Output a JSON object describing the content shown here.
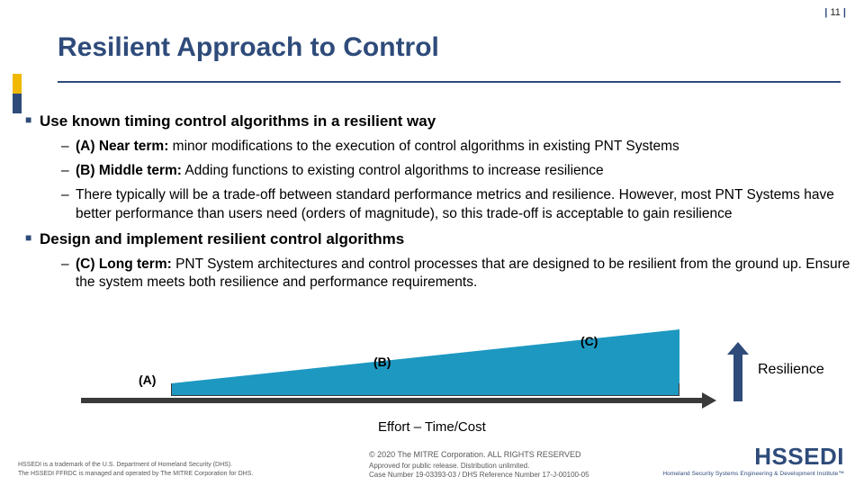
{
  "page": {
    "num": "11"
  },
  "title": "Resilient Approach to Control",
  "bullets": {
    "a": {
      "head": "Use known timing control algorithms in a resilient way",
      "i1label": "(A) Near term:",
      "i1text": " minor modifications to the execution of control algorithms in existing PNT Systems",
      "i2label": "(B) Middle term:",
      "i2text": " Adding functions to existing control algorithms to increase resilience",
      "i3text": "There typically will be a trade-off between standard performance metrics and resilience.  However, most PNT Systems have better performance than users need (orders of magnitude), so this trade-off is acceptable to gain resilience"
    },
    "b": {
      "head": "Design and implement resilient control algorithms",
      "i1label": "(C) Long term:",
      "i1text": " PNT System architectures and control processes that are designed to be resilient from the ground up.  Ensure the system meets both resilience and performance requirements."
    }
  },
  "diagram": {
    "A": "(A)",
    "B": "(B)",
    "C": "(C)",
    "xlabel": "Effort – Time/Cost",
    "ylabel": "Resilience"
  },
  "footer": {
    "copyright": "© 2020 The MITRE Corporation. ALL RIGHTS RESERVED",
    "approved": "Approved for public release. Distribution unlimited.",
    "casenum": "Case Number 19-03393-03 / DHS Reference Number 17-J-00100-05",
    "tm1": "HSSEDI is a trademark of the U.S. Department of Homeland Security (DHS).",
    "tm2": "The HSSEDI FFRDC is managed and operated by The MITRE Corporation for DHS."
  },
  "logo": {
    "name": "HSSEDI",
    "tag": "Homeland Security Systems Engineering & Development Institute™"
  }
}
